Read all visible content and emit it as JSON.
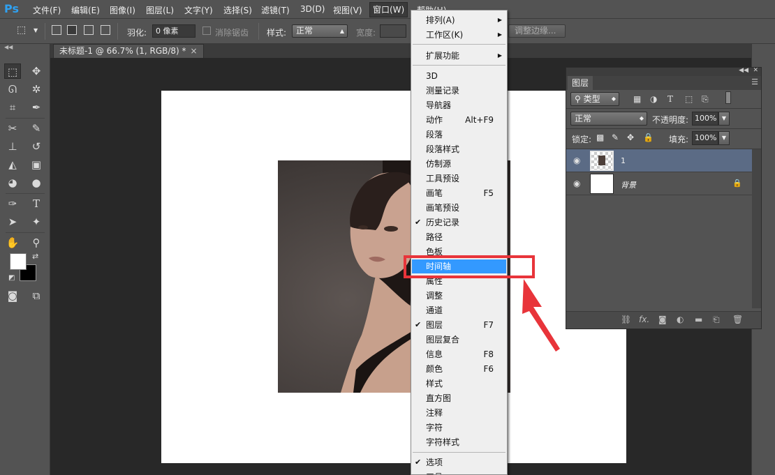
{
  "app": {
    "logo": "Ps"
  },
  "menubar": {
    "items": [
      "文件(F)",
      "编辑(E)",
      "图像(I)",
      "图层(L)",
      "文字(Y)",
      "选择(S)",
      "滤镜(T)",
      "3D(D)",
      "视图(V)",
      "窗口(W)",
      "帮助(H)"
    ],
    "active": "窗口(W)"
  },
  "options": {
    "feather_label": "羽化:",
    "feather_value": "0 像素",
    "antialias_label": "消除锯齿",
    "style_label": "样式:",
    "style_value": "正常",
    "width_label": "宽度:",
    "refine_button": "调整边缘..."
  },
  "document": {
    "tab_title": "未标题-1 @ 66.7% (1, RGB/8) *",
    "close_glyph": "×"
  },
  "tools": {
    "icons": [
      "rect-marquee",
      "move",
      "lasso",
      "magic-wand",
      "crop",
      "eyedropper",
      "healing",
      "brush",
      "clone-stamp",
      "history-brush",
      "eraser",
      "gradient",
      "blur",
      "dodge",
      "pen",
      "type",
      "path-select",
      "shape",
      "hand",
      "zoom",
      "quick-mask",
      "screen-mode"
    ],
    "type_tool_glyph": "T"
  },
  "window_menu": {
    "items": [
      {
        "label": "排列(A)",
        "submenu": true
      },
      {
        "label": "工作区(K)",
        "submenu": true
      },
      {
        "separator": true
      },
      {
        "label": "扩展功能",
        "submenu": true
      },
      {
        "separator": true
      },
      {
        "label": "3D"
      },
      {
        "label": "测量记录"
      },
      {
        "label": "导航器"
      },
      {
        "label": "动作",
        "shortcut": "Alt+F9"
      },
      {
        "label": "段落"
      },
      {
        "label": "段落样式"
      },
      {
        "label": "仿制源"
      },
      {
        "label": "工具预设"
      },
      {
        "label": "画笔",
        "shortcut": "F5"
      },
      {
        "label": "画笔预设"
      },
      {
        "label": "历史记录",
        "checked": true
      },
      {
        "label": "路径"
      },
      {
        "label": "色板"
      },
      {
        "label": "时间轴",
        "highlighted": true
      },
      {
        "label": "属性"
      },
      {
        "label": "调整"
      },
      {
        "label": "通道"
      },
      {
        "label": "图层",
        "shortcut": "F7",
        "checked": true
      },
      {
        "label": "图层复合"
      },
      {
        "label": "信息",
        "shortcut": "F8"
      },
      {
        "label": "颜色",
        "shortcut": "F6"
      },
      {
        "label": "样式"
      },
      {
        "label": "直方图"
      },
      {
        "label": "注释"
      },
      {
        "label": "字符"
      },
      {
        "label": "字符样式"
      },
      {
        "separator": true
      },
      {
        "label": "选项",
        "checked": true
      },
      {
        "label": "工具"
      }
    ],
    "check_glyph": "✔",
    "submenu_glyph": "▶"
  },
  "layers_panel": {
    "tab_label": "图层",
    "filter_kind": "类型",
    "blend_mode": "正常",
    "opacity_label": "不透明度:",
    "opacity_value": "100%",
    "lock_label": "锁定:",
    "fill_label": "填充:",
    "fill_value": "100%",
    "layers": [
      {
        "name": "1",
        "selected": true,
        "visible": true,
        "locked": false
      },
      {
        "name": "背景",
        "selected": false,
        "visible": true,
        "locked": true
      }
    ],
    "footer_fx": "fx."
  },
  "colors": {
    "accent": "#3399ff",
    "annotation": "#e8343a",
    "selected_layer": "#5b6b85"
  }
}
